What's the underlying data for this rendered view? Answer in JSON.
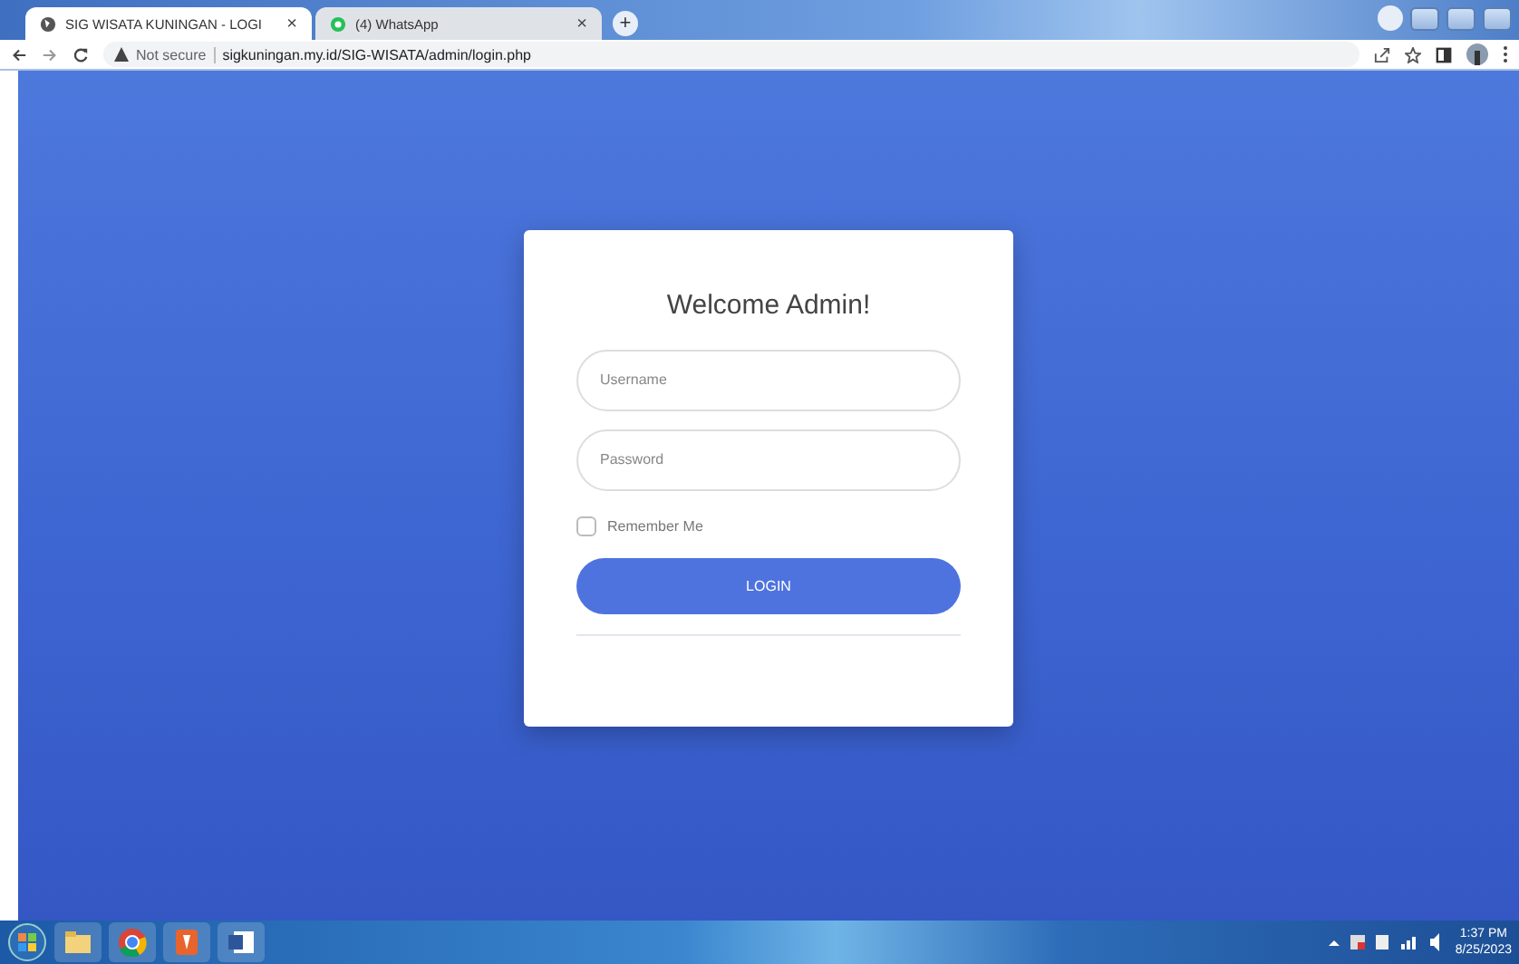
{
  "browser": {
    "tabs": [
      {
        "title": "SIG WISATA KUNINGAN - LOGI",
        "selected": true,
        "close": "×"
      },
      {
        "title": "(4) WhatsApp",
        "selected": false,
        "close": "×"
      }
    ],
    "new_tab": "+",
    "address": {
      "security": "Not secure",
      "url": "sigkuningan.my.id/SIG-WISATA/admin/login.php"
    }
  },
  "login": {
    "title": "Welcome Admin!",
    "username": {
      "placeholder": "Username"
    },
    "password": {
      "placeholder": "Password"
    },
    "remember": {
      "label": "Remember Me",
      "checked": false
    },
    "button": "LOGIN"
  },
  "taskbar": {
    "time": "1:37 PM",
    "date": "8/25/2023"
  }
}
